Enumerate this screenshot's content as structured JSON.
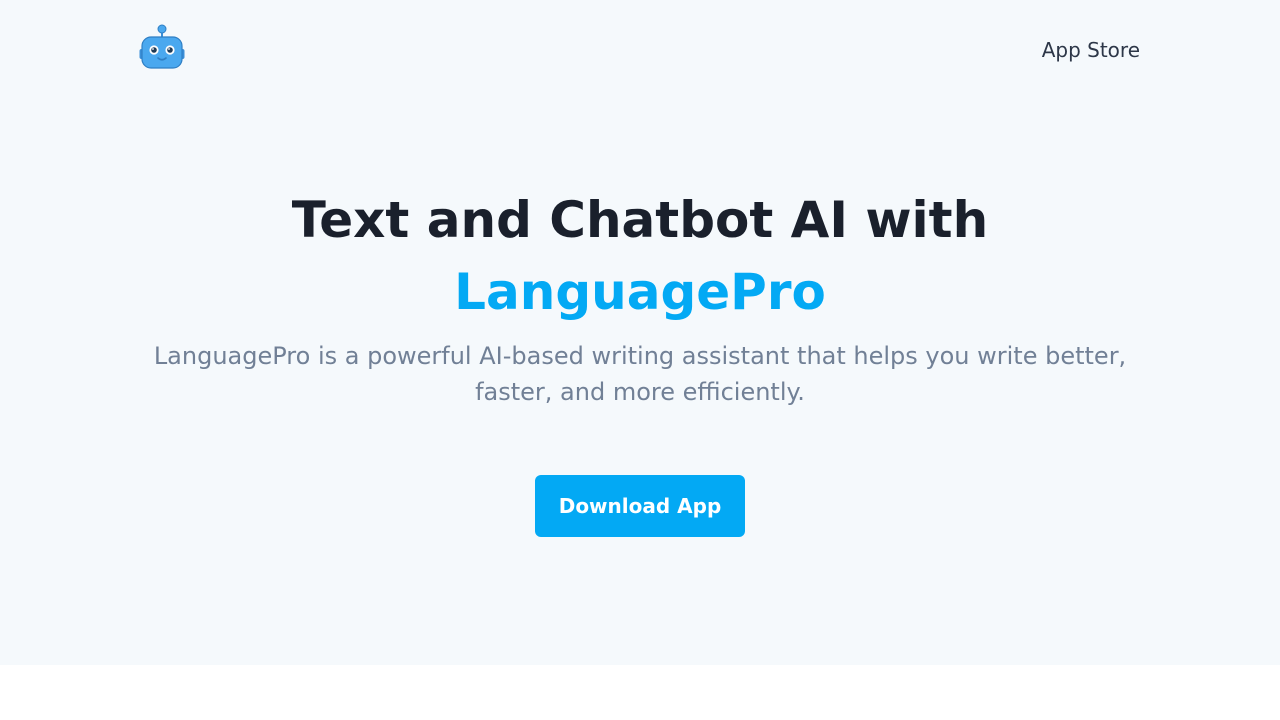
{
  "header": {
    "logo_icon": "robot-icon",
    "nav_link": "App Store"
  },
  "hero": {
    "headline": "Text and Chatbot AI with",
    "headline_accent": "LanguagePro",
    "subtitle": "LanguagePro is a powerful AI-based writing assistant that helps you write better, faster, and more efficiently.",
    "cta_label": "Download App"
  },
  "colors": {
    "accent": "#03a9f4",
    "hero_background": "#f5f9fc",
    "heading": "#1a202c",
    "body_text": "#718096"
  }
}
